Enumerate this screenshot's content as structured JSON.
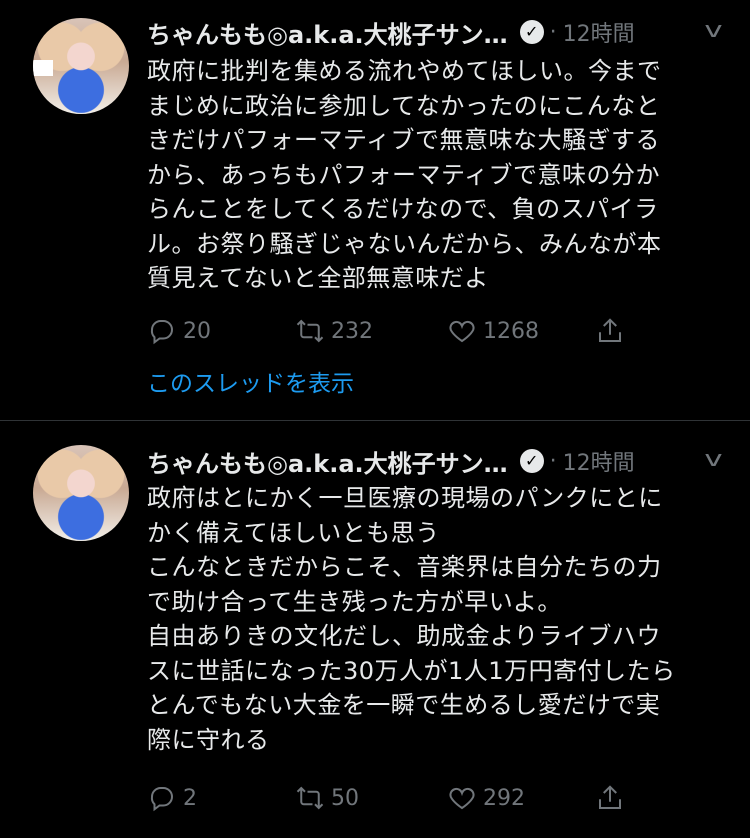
{
  "tweets": [
    {
      "name": "ちゃんもも◎a.k.a.大桃子サン…",
      "time": "12時間",
      "text": "政府に批判を集める流れやめてほしい。今まで\nまじめに政治に参加してなかったのにこんなと\nきだけパフォーマティブで無意味な大騒ぎする\nから、あっちもパフォーマティブで意味の分か\nらんことをしてくるだけなので、負のスパイラ\nル。お祭り騒ぎじゃないんだから、みんなが本\n質見えてないと全部無意味だよ",
      "replies": "20",
      "retweets": "232",
      "likes": "1268",
      "thread_link": "このスレッドを表示"
    },
    {
      "name": "ちゃんもも◎a.k.a.大桃子サン…",
      "time": "12時間",
      "text": "政府はとにかく一旦医療の現場のパンクにとに\nかく備えてほしいとも思う\nこんなときだからこそ、音楽界は自分たちの力\nで助け合って生き残った方が早いよ。\n自由ありきの文化だし、助成金よりライブハウ\nスに世話になった30万人が1人1万円寄付したら\nとんでもない大金を一瞬で生めるし愛だけで実\n際に守れる",
      "replies": "2",
      "retweets": "50",
      "likes": "292"
    }
  ],
  "icons": {
    "verified": "verified-badge-icon",
    "menu": "chevron-down-icon",
    "reply": "reply-icon",
    "retweet": "retweet-icon",
    "like": "heart-icon",
    "share": "share-icon"
  },
  "colors": {
    "background": "#000000",
    "text": "#e7e9ea",
    "muted": "#71767b",
    "link": "#1d9bf0"
  }
}
